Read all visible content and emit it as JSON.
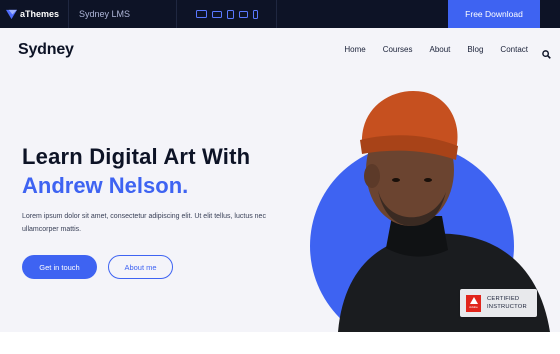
{
  "topbar": {
    "brand_name": "aThemes",
    "site_name": "Sydney LMS",
    "devices": [
      "desktop-icon",
      "laptop-icon",
      "tablet-icon",
      "tablet-landscape-icon",
      "phone-icon"
    ],
    "download_label": "Free Download",
    "accent_color": "#3e63f2",
    "background_color": "#0d1326"
  },
  "header": {
    "logo_text": "Sydney",
    "nav_items": [
      "Home",
      "Courses",
      "About",
      "Blog",
      "Contact"
    ]
  },
  "hero": {
    "headline": "Learn Digital Art With",
    "headline_accent": "Andrew Nelson.",
    "description": "Lorem ipsum dolor sit amet, consectetur adipiscing elit. Ut elit tellus, luctus nec ullamcorper mattis.",
    "primary_button": "Get in touch",
    "secondary_button": "About me",
    "badge_logo": "Adobe",
    "badge_line1": "CERTIFIED",
    "badge_line2": "INSTRUCTOR"
  }
}
